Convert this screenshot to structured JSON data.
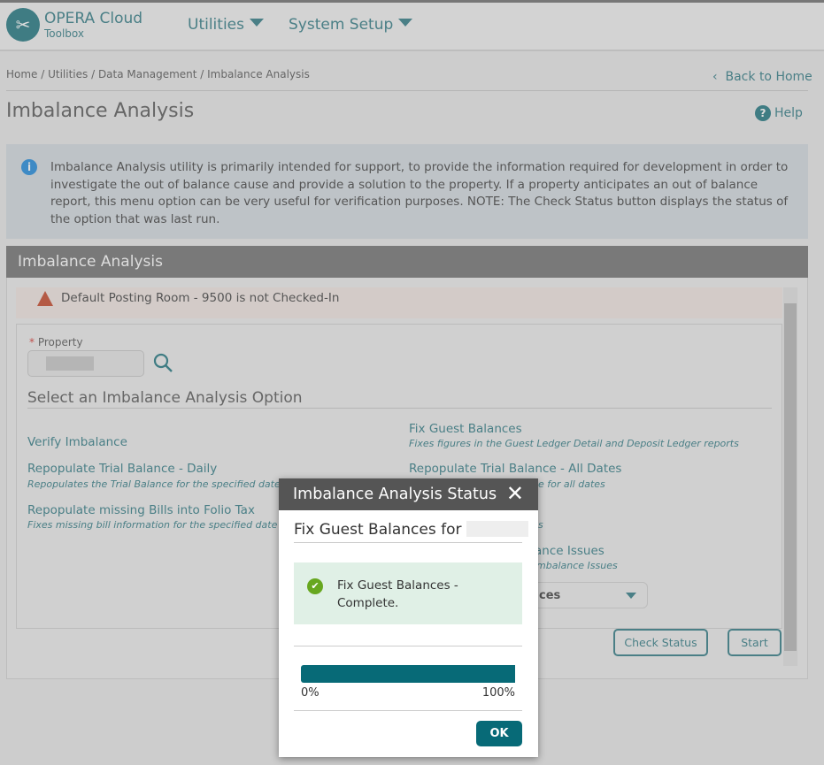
{
  "header": {
    "brand": "OPERA Cloud",
    "sub": "Toolbox",
    "nav": [
      "Utilities",
      "System Setup"
    ]
  },
  "breadcrumb": "Home / Utilities / Data Management / Imbalance Analysis",
  "back": "Back to Home",
  "title": "Imbalance Analysis",
  "help": "Help",
  "info": "Imbalance Analysis utility is primarily intended for support, to provide the information required for development in order to investigate the out of balance cause and provide a solution to the property. If a property anticipates an out of balance report, this menu option can be very useful for verification purposes. NOTE: The Check Status button displays the status of the option that was last run.",
  "section": "Imbalance Analysis",
  "warning": "Default Posting Room - 9500 is not Checked-In",
  "property_label": "Property",
  "options_title": "Select an Imbalance Analysis Option",
  "options_left": [
    {
      "label": "Verify Imbalance",
      "desc": ""
    },
    {
      "label": "Repopulate Trial Balance - Daily",
      "desc": "Repopulates the Trial Balance for the specified date"
    },
    {
      "label": "Repopulate missing Bills into Folio Tax",
      "desc": "Fixes missing bill information for the specified date"
    }
  ],
  "options_right": [
    {
      "label": "Fix Guest Balances",
      "desc": "Fixes figures in the Guest Ledger Detail and Deposit Ledger reports"
    },
    {
      "label": "Repopulate Trial Balance - All Dates",
      "desc": "e for all dates"
    },
    {
      "label": "",
      "desc": "s"
    },
    {
      "label": "ance Issues",
      "desc": "mbalance Issues"
    }
  ],
  "select_value": "ces",
  "buttons": {
    "check": "Check Status",
    "start": "Start"
  },
  "dialog": {
    "title": "Imbalance Analysis Status",
    "subtitle": "Fix Guest Balances for",
    "message": "Fix Guest Balances - Complete.",
    "progress": 100,
    "min": "0%",
    "max": "100%",
    "ok": "OK"
  }
}
